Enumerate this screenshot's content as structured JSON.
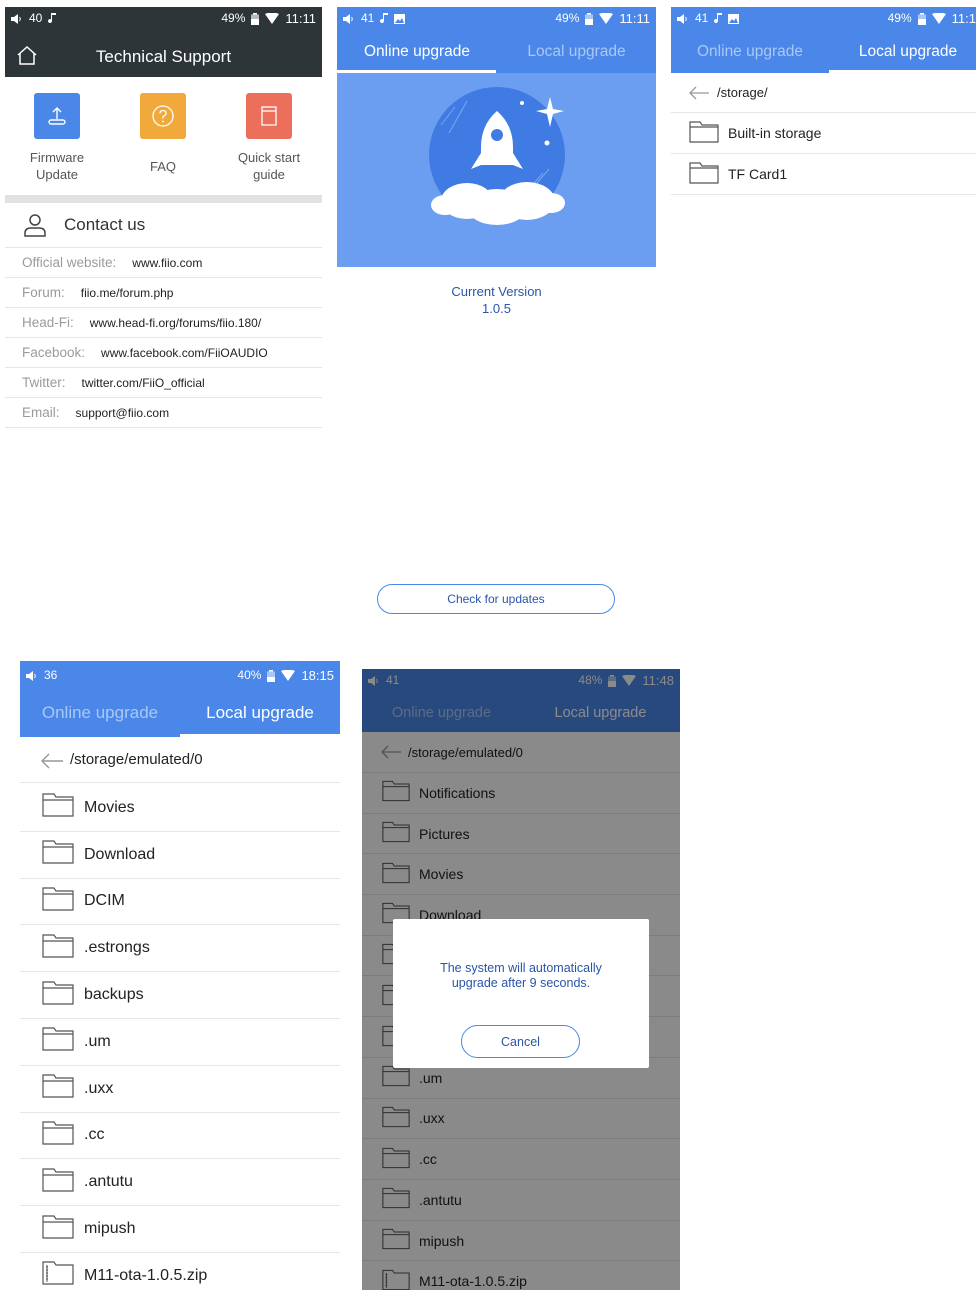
{
  "panel1": {
    "status": {
      "volume": "40",
      "battery": "49%",
      "time": "11:11"
    },
    "title": "Technical Support",
    "tiles": [
      {
        "label_line1": "Firmware",
        "label_line2": "Update",
        "icon": "upload-icon",
        "color": "#4a87e8"
      },
      {
        "label_line1": "FAQ",
        "label_line2": "",
        "icon": "question-icon",
        "color": "#f0a93a"
      },
      {
        "label_line1": "Quick start",
        "label_line2": "guide",
        "icon": "book-icon",
        "color": "#ec6f5b"
      }
    ],
    "contact_title": "Contact us",
    "contacts": [
      {
        "key": "Official website:",
        "value": "www.fiio.com"
      },
      {
        "key": "Forum:",
        "value": "fiio.me/forum.php"
      },
      {
        "key": "Head-Fi:",
        "value": "www.head-fi.org/forums/fiio.180/"
      },
      {
        "key": "Facebook:",
        "value": "www.facebook.com/FiiOAUDIO"
      },
      {
        "key": "Twitter:",
        "value": "twitter.com/FiiO_official"
      },
      {
        "key": "Email:",
        "value": "support@fiio.com"
      }
    ]
  },
  "panel2": {
    "status": {
      "volume": "41",
      "battery": "49%",
      "time": "11:11"
    },
    "tabs": {
      "online": "Online upgrade",
      "local": "Local upgrade"
    },
    "version_label": "Current Version",
    "version_value": "1.0.5",
    "check_button": "Check for updates"
  },
  "panel3": {
    "status": {
      "volume": "41",
      "battery": "49%",
      "time": "11:1"
    },
    "tabs": {
      "online": "Online upgrade",
      "local": "Local upgrade"
    },
    "path": "/storage/",
    "folders": [
      "Built-in storage",
      "TF Card1"
    ]
  },
  "panel4": {
    "status": {
      "volume": "36",
      "battery": "40%",
      "time": "18:15"
    },
    "tabs": {
      "online": "Online upgrade",
      "local": "Local upgrade"
    },
    "path": "/storage/emulated/0",
    "folders": [
      "Movies",
      "Download",
      "DCIM",
      ".estrongs",
      "backups",
      ".um",
      ".uxx",
      ".cc",
      ".antutu",
      "mipush"
    ],
    "zip_file": "M11-ota-1.0.5.zip"
  },
  "panel5": {
    "status": {
      "volume": "41",
      "battery": "48%",
      "time": "11:48"
    },
    "tabs": {
      "online": "Online upgrade",
      "local": "Local upgrade"
    },
    "path": "/storage/emulated/0",
    "folders": [
      "Notifications",
      "Pictures",
      "Movies",
      "Download",
      "",
      "",
      "",
      ".um",
      ".uxx",
      ".cc",
      ".antutu",
      "mipush"
    ],
    "zip_file": "M11-ota-1.0.5.zip",
    "dialog": {
      "line1": "The system will automatically",
      "line2": "upgrade after 9 seconds.",
      "cancel": "Cancel"
    }
  }
}
